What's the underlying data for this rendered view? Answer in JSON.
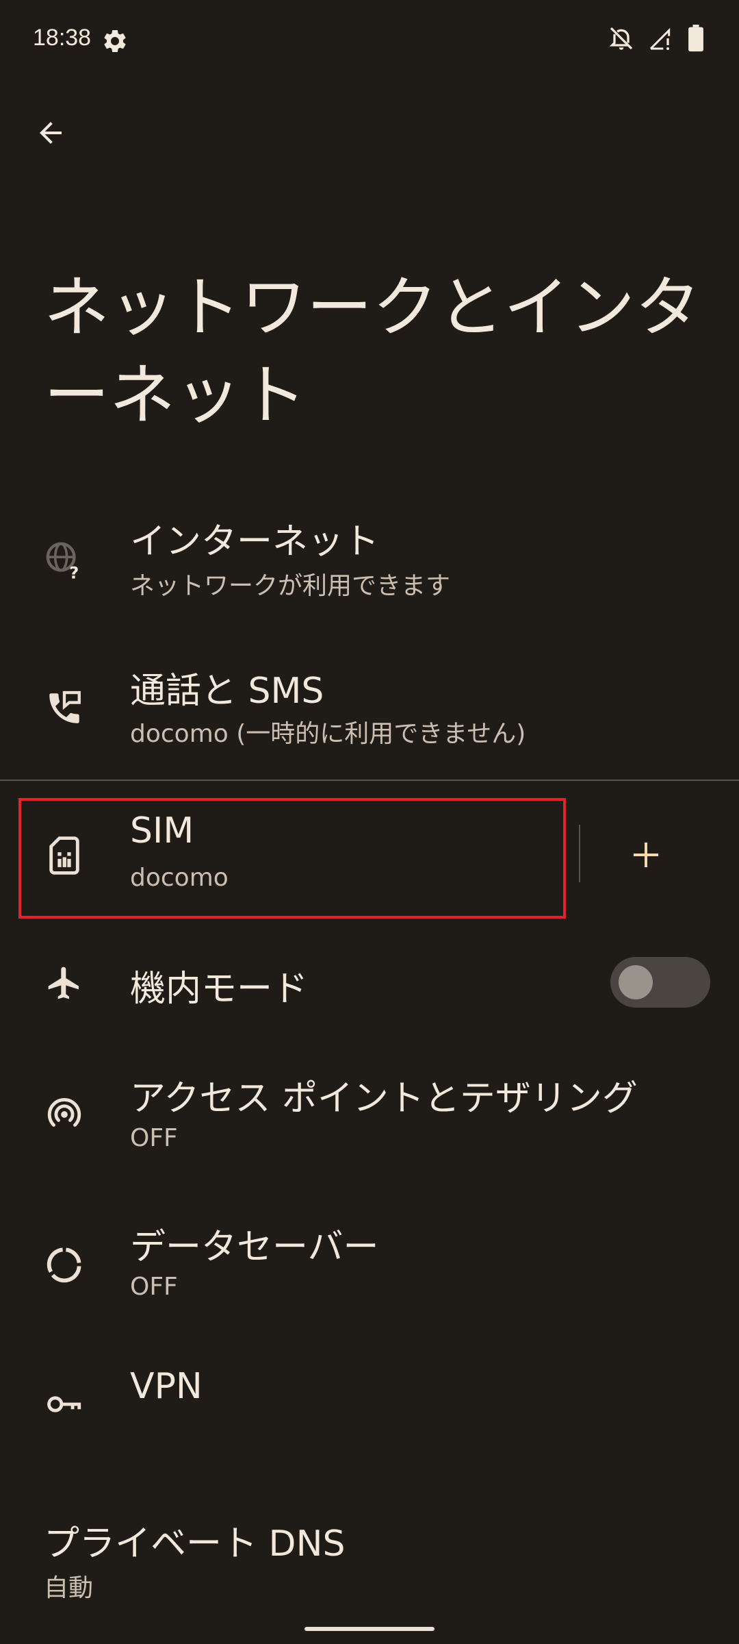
{
  "status_bar": {
    "time": "18:38",
    "icons": [
      "settings-icon",
      "notifications-off-icon",
      "signal-no-service-icon",
      "battery-icon"
    ]
  },
  "header": {
    "back_icon": "arrow-back-icon",
    "title": "ネットワークとインターネット"
  },
  "items": [
    {
      "icon": "globe-question-icon",
      "title": "インターネット",
      "subtitle": "ネットワークが利用できます"
    },
    {
      "icon": "phone-message-icon",
      "title": "通話と SMS",
      "subtitle": "docomo (一時的に利用できません)"
    },
    {
      "icon": "sim-card-icon",
      "title": "SIM",
      "subtitle": "docomo"
    },
    {
      "icon": "airplane-icon",
      "title": "機内モード",
      "toggle": "off"
    },
    {
      "icon": "hotspot-icon",
      "title": "アクセス ポイントとテザリング",
      "subtitle": "OFF"
    },
    {
      "icon": "data-saver-icon",
      "title": "データセーバー",
      "subtitle": "OFF"
    },
    {
      "icon": "vpn-key-icon",
      "title": "VPN"
    },
    {
      "title": "プライベート DNS",
      "subtitle": "自動"
    }
  ],
  "sim_add_icon": "plus-icon",
  "colors": {
    "background": "#1f1b17",
    "text_primary": "#f2e8dc",
    "text_secondary": "#cbbfb1",
    "accent": "#f5d9a8",
    "highlight": "#e0242c"
  }
}
